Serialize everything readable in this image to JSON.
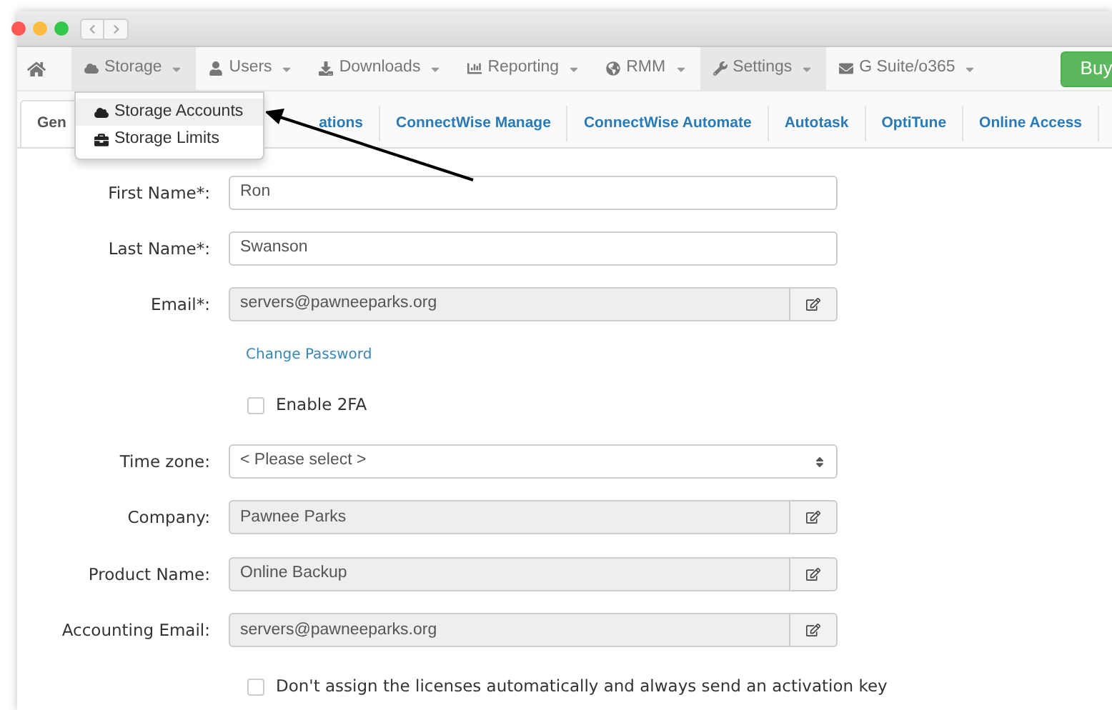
{
  "navbar": {
    "items": [
      {
        "label": "Storage",
        "selected": true
      },
      {
        "label": "Users",
        "selected": false
      },
      {
        "label": "Downloads",
        "selected": false
      },
      {
        "label": "Reporting",
        "selected": false
      },
      {
        "label": "RMM",
        "selected": false
      },
      {
        "label": "Settings",
        "selected": true
      },
      {
        "label": "G Suite/o365",
        "selected": false
      }
    ],
    "buy": "Buy"
  },
  "dropdown": {
    "items": [
      {
        "label": "Storage Accounts",
        "selected": true
      },
      {
        "label": "Storage Limits",
        "selected": false
      }
    ]
  },
  "tabs": [
    {
      "label": "Gen",
      "selected": true
    },
    {
      "label": "ations",
      "selected": false
    },
    {
      "label": "ConnectWise Manage",
      "selected": false
    },
    {
      "label": "ConnectWise Automate",
      "selected": false
    },
    {
      "label": "Autotask",
      "selected": false
    },
    {
      "label": "OptiTune",
      "selected": false
    },
    {
      "label": "Online Access",
      "selected": false
    }
  ],
  "form": [
    {
      "kind": "text",
      "label": "First Name*:",
      "value": "Ron"
    },
    {
      "kind": "text",
      "label": "Last Name*:",
      "value": "Swanson"
    },
    {
      "kind": "locked",
      "label": "Email*:",
      "value": "servers@pawneeparks.org"
    },
    {
      "kind": "link",
      "text": "Change Password"
    },
    {
      "kind": "checkbox",
      "text": "Enable 2FA",
      "checked": false
    },
    {
      "kind": "select",
      "label": "Time zone:",
      "value": "< Please select >"
    },
    {
      "kind": "locked",
      "label": "Company:",
      "value": "Pawnee Parks"
    },
    {
      "kind": "locked",
      "label": "Product Name:",
      "value": "Online Backup"
    },
    {
      "kind": "locked",
      "label": "Accounting Email:",
      "value": "servers@pawneeparks.org"
    },
    {
      "kind": "checkbox",
      "text": "Don't assign the licenses automatically and always send an activation key",
      "checked": false
    }
  ]
}
